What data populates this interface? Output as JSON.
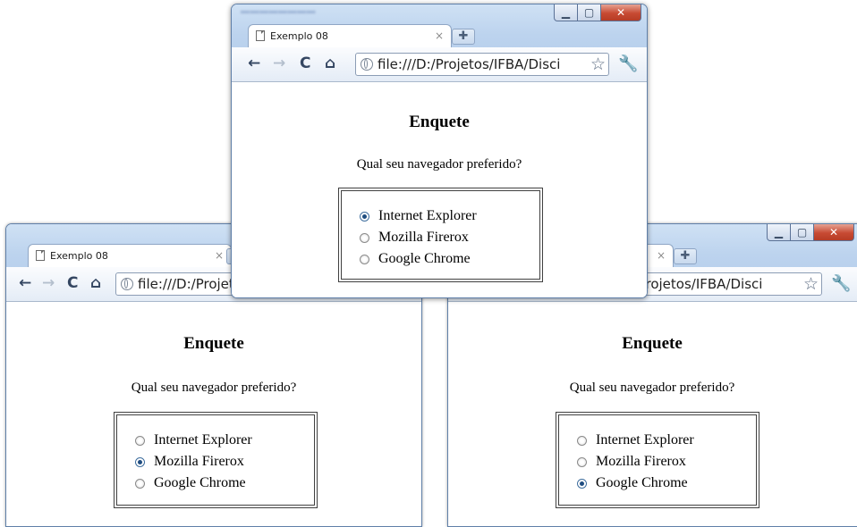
{
  "tab_title": "Exemplo 08",
  "address": "file:///D:/Projetos/IFBA/Disci",
  "poll": {
    "heading": "Enquete",
    "question": "Qual seu navegador preferido?",
    "options": [
      "Internet Explorer",
      "Mozilla Firerox",
      "Google Chrome"
    ]
  },
  "windows": [
    {
      "id": "left",
      "selected_option": "Mozilla Firerox"
    },
    {
      "id": "right",
      "selected_option": "Google Chrome"
    },
    {
      "id": "top",
      "selected_option": "Internet Explorer"
    }
  ],
  "icons": {
    "back": "back-arrow-icon",
    "forward": "forward-arrow-icon",
    "reload": "reload-icon",
    "home": "home-icon",
    "page": "page-icon",
    "globe": "globe-icon",
    "bookmark": "star-icon",
    "settings": "wrench-icon",
    "minimize": "minimize-icon",
    "maximize": "maximize-icon",
    "close": "close-icon",
    "new_tab": "new-tab-icon"
  },
  "colors": {
    "frame": "#bcd3ee",
    "window_border": "#5f7fa8",
    "close_button": "#c74a33",
    "radio_selected": "#1f4d80"
  }
}
